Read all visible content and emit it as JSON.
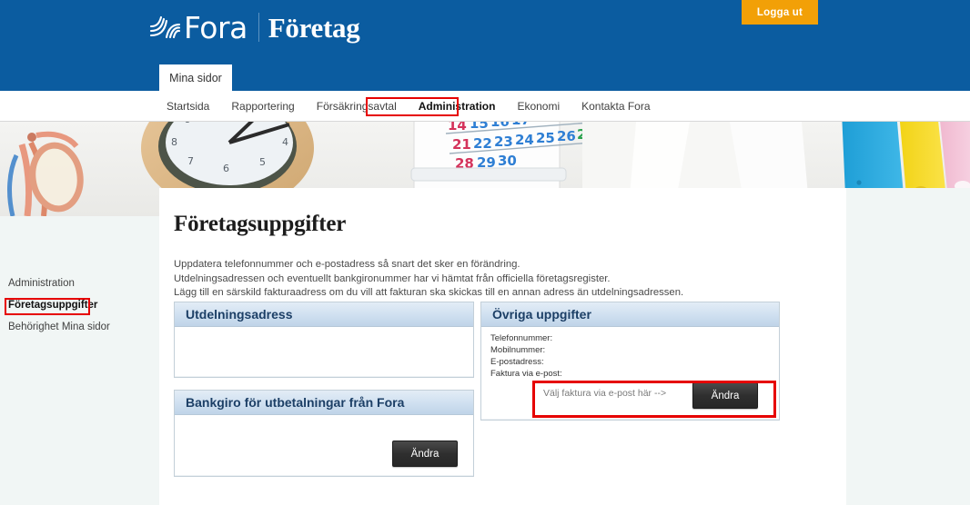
{
  "header": {
    "logo_primary": "Fora",
    "logo_secondary": "Företag",
    "logo_mark_icon": "fora-wave-logo-icon",
    "logout_label": "Logga ut",
    "brand_blue": "#0b5ca0",
    "logout_orange": "#f2a007"
  },
  "tab": {
    "label": "Mina sidor"
  },
  "nav": {
    "items": [
      {
        "label": "Startsida",
        "active": false
      },
      {
        "label": "Rapportering",
        "active": false
      },
      {
        "label": "Försäkringsavtal",
        "active": false
      },
      {
        "label": "Administration",
        "active": true
      },
      {
        "label": "Ekonomi",
        "active": false
      },
      {
        "label": "Kontakta Fora",
        "active": false
      }
    ],
    "highlight_color": "#e60000"
  },
  "sidebar": {
    "items": [
      {
        "label": "Administration",
        "active": false
      },
      {
        "label": "Företagsuppgifter",
        "active": true
      },
      {
        "label": "Behörighet Mina sidor",
        "active": false
      }
    ]
  },
  "main": {
    "title": "Företagsuppgifter",
    "intro_lines": [
      "Uppdatera telefonnummer och e-postadress så snart det sker en förändring.",
      "Utdelningsadressen och eventuellt bankgironummer har vi hämtat från officiella företagsregister.",
      "Lägg till en särskild fakturaadress om du vill att fakturan ska skickas till en annan adress än utdelningsadressen."
    ]
  },
  "panels": {
    "utdelningsadress": {
      "title": "Utdelningsadress",
      "body_value": ""
    },
    "bankgiro": {
      "title": "Bankgiro för utbetalningar från Fora",
      "button_label": "Ändra"
    },
    "ovriga_uppgifter": {
      "title": "Övriga uppgifter",
      "fields": [
        {
          "label": "Telefonnummer:",
          "value": ""
        },
        {
          "label": "Mobilnummer:",
          "value": ""
        },
        {
          "label": "E-postadress:",
          "value": ""
        },
        {
          "label": "Faktura via e-post:",
          "value": ""
        }
      ],
      "hint": "Välj faktura via e-post här -->",
      "button_label": "Ändra"
    }
  }
}
